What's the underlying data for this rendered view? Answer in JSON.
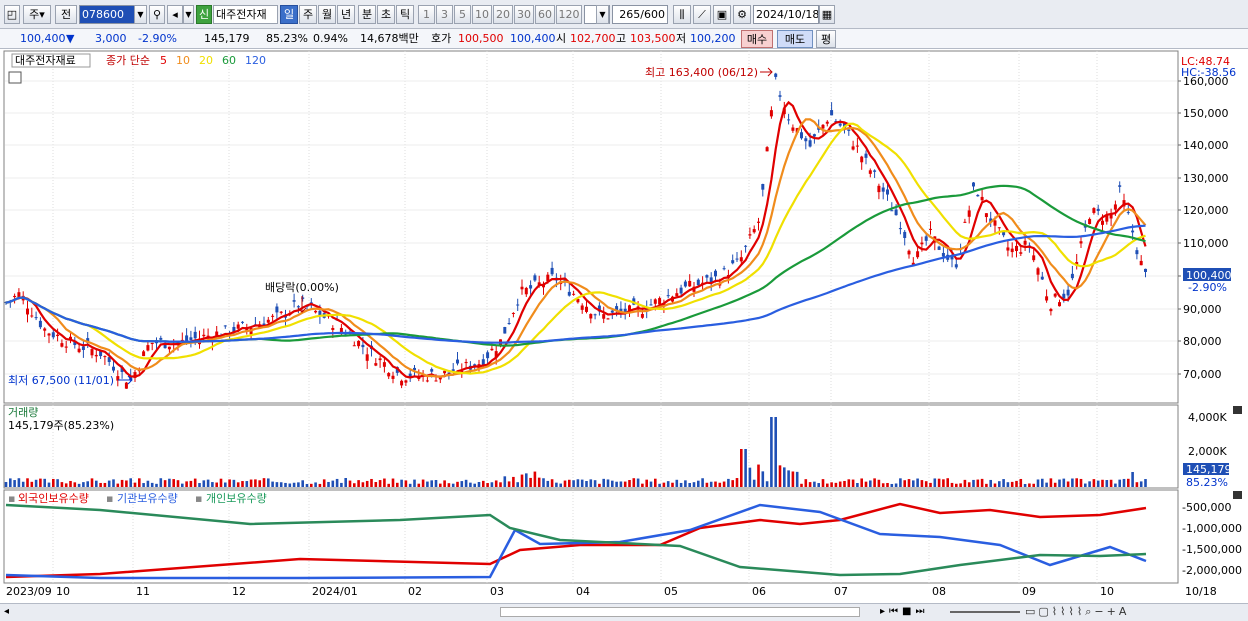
{
  "toolbar": {
    "market_label": "주",
    "type_label": "전",
    "code": "078600",
    "stock_name": "대주전자재",
    "credit_badge": "신",
    "periods": [
      "일",
      "주",
      "월",
      "년",
      "분",
      "초",
      "틱"
    ],
    "intervals": [
      "1",
      "3",
      "5",
      "10",
      "20",
      "30",
      "60",
      "120"
    ],
    "count": "265",
    "count_total": "/600",
    "date": "2024/10/18"
  },
  "quote": {
    "price": "100,400",
    "arrow": "▼",
    "change": "3,000",
    "change_pct": "-2.90%",
    "volume": "145,179",
    "vol_ratio": "85.23%",
    "turnover_pct": "0.94%",
    "amount": "14,678백만",
    "ask_label": "호가",
    "ask": "100,500",
    "bid": "100,400",
    "open_label": "시",
    "open": "102,700",
    "high_label": "고",
    "high": "103,500",
    "low_label": "저",
    "low": "100,200",
    "buy_button": "매수",
    "sell_button": "매도",
    "avg_button": "평"
  },
  "price_panel": {
    "legend_name": "대주전자재료",
    "legend_type": "종가 단순",
    "ma": [
      {
        "label": "5",
        "color": "#e00000"
      },
      {
        "label": "10",
        "color": "#f08c1c"
      },
      {
        "label": "20",
        "color": "#f0e000"
      },
      {
        "label": "60",
        "color": "#1a9a3a"
      },
      {
        "label": "120",
        "color": "#2a5ee0"
      }
    ],
    "lc": "LC:48.74",
    "hc": "HC:-38.56",
    "y_ticks": [
      "160,000",
      "150,000",
      "140,000",
      "130,000",
      "120,000",
      "110,000",
      "100,000",
      "90,000",
      "80,000",
      "70,000"
    ],
    "current_price": "100,400",
    "current_pct": "-2.90%",
    "high_note": "최고 163,400 (06/12)",
    "low_note": "최저 67,500 (11/01)",
    "dividend_note": "배당락(0.00%)"
  },
  "volume_panel": {
    "title": "거래량",
    "value": "145,179주(85.23%)",
    "y_ticks": [
      "4,000K",
      "2,000K"
    ],
    "current": "145,179",
    "current_pct": "85.23%"
  },
  "holding_panel": {
    "series": [
      "외국인보유수량",
      "기관보유수량",
      "개인보유수량"
    ],
    "y_ticks": [
      "-500,000",
      "-1,000,000",
      "-1,500,000",
      "-2,000,000"
    ]
  },
  "x_axis": [
    "2023/09",
    "10",
    "11",
    "12",
    "2024/01",
    "02",
    "03",
    "04",
    "05",
    "06",
    "07",
    "08",
    "09",
    "10",
    "10/18"
  ]
}
